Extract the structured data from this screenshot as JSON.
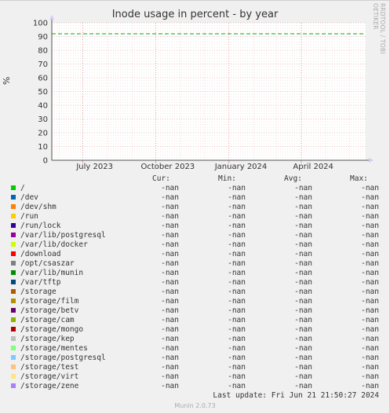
{
  "chart_data": {
    "type": "line",
    "title": "Inode usage in percent - by year",
    "ylabel": "%",
    "xlabel": "",
    "ylim": [
      0,
      100
    ],
    "xlim": [
      "2023-05-23",
      "2024-06-21"
    ],
    "y_ticks": [
      "0",
      "10",
      "20",
      "30",
      "40",
      "50",
      "60",
      "70",
      "80",
      "90",
      "100"
    ],
    "x_ticks": [
      {
        "label": "July 2023",
        "date": "2023-07-01"
      },
      {
        "label": "October 2023",
        "date": "2023-10-01"
      },
      {
        "label": "January 2024",
        "date": "2024-01-01"
      },
      {
        "label": "April 2024",
        "date": "2024-04-01"
      }
    ],
    "grid": true,
    "reference_line": {
      "value": 92,
      "color": "#00aa00",
      "style": "dashed"
    },
    "watermark": "RRDTOOL / TOBI OETIKER",
    "legend_headers": [
      "Cur:",
      "Min:",
      "Avg:",
      "Max:"
    ],
    "series": [
      {
        "name": "/",
        "color": "#00cc00",
        "cur": "-nan",
        "min": "-nan",
        "avg": "-nan",
        "max": "-nan"
      },
      {
        "name": "/dev",
        "color": "#0066b3",
        "cur": "-nan",
        "min": "-nan",
        "avg": "-nan",
        "max": "-nan"
      },
      {
        "name": "/dev/shm",
        "color": "#ff8000",
        "cur": "-nan",
        "min": "-nan",
        "avg": "-nan",
        "max": "-nan"
      },
      {
        "name": "/run",
        "color": "#ffcc00",
        "cur": "-nan",
        "min": "-nan",
        "avg": "-nan",
        "max": "-nan"
      },
      {
        "name": "/run/lock",
        "color": "#330099",
        "cur": "-nan",
        "min": "-nan",
        "avg": "-nan",
        "max": "-nan"
      },
      {
        "name": "/var/lib/postgresql",
        "color": "#990099",
        "cur": "-nan",
        "min": "-nan",
        "avg": "-nan",
        "max": "-nan"
      },
      {
        "name": "/var/lib/docker",
        "color": "#ccff00",
        "cur": "-nan",
        "min": "-nan",
        "avg": "-nan",
        "max": "-nan"
      },
      {
        "name": "/download",
        "color": "#ff0000",
        "cur": "-nan",
        "min": "-nan",
        "avg": "-nan",
        "max": "-nan"
      },
      {
        "name": "/opt/csaszar",
        "color": "#808080",
        "cur": "-nan",
        "min": "-nan",
        "avg": "-nan",
        "max": "-nan"
      },
      {
        "name": "/var/lib/munin",
        "color": "#008f00",
        "cur": "-nan",
        "min": "-nan",
        "avg": "-nan",
        "max": "-nan"
      },
      {
        "name": "/var/tftp",
        "color": "#00487d",
        "cur": "-nan",
        "min": "-nan",
        "avg": "-nan",
        "max": "-nan"
      },
      {
        "name": "/storage",
        "color": "#b35a00",
        "cur": "-nan",
        "min": "-nan",
        "avg": "-nan",
        "max": "-nan"
      },
      {
        "name": "/storage/film",
        "color": "#b38f00",
        "cur": "-nan",
        "min": "-nan",
        "avg": "-nan",
        "max": "-nan"
      },
      {
        "name": "/storage/betv",
        "color": "#6b006b",
        "cur": "-nan",
        "min": "-nan",
        "avg": "-nan",
        "max": "-nan"
      },
      {
        "name": "/storage/cam",
        "color": "#8fb300",
        "cur": "-nan",
        "min": "-nan",
        "avg": "-nan",
        "max": "-nan"
      },
      {
        "name": "/storage/mongo",
        "color": "#b30000",
        "cur": "-nan",
        "min": "-nan",
        "avg": "-nan",
        "max": "-nan"
      },
      {
        "name": "/storage/kep",
        "color": "#bebebe",
        "cur": "-nan",
        "min": "-nan",
        "avg": "-nan",
        "max": "-nan"
      },
      {
        "name": "/storage/mentes",
        "color": "#80ff80",
        "cur": "-nan",
        "min": "-nan",
        "avg": "-nan",
        "max": "-nan"
      },
      {
        "name": "/storage/postgresql",
        "color": "#80c9ff",
        "cur": "-nan",
        "min": "-nan",
        "avg": "-nan",
        "max": "-nan"
      },
      {
        "name": "/storage/test",
        "color": "#ffc080",
        "cur": "-nan",
        "min": "-nan",
        "avg": "-nan",
        "max": "-nan"
      },
      {
        "name": "/storage/virt",
        "color": "#ffe680",
        "cur": "-nan",
        "min": "-nan",
        "avg": "-nan",
        "max": "-nan"
      },
      {
        "name": "/storage/zene",
        "color": "#aa80ff",
        "cur": "-nan",
        "min": "-nan",
        "avg": "-nan",
        "max": "-nan"
      }
    ]
  },
  "last_update": "Last update: Fri Jun 21 21:50:27 2024",
  "footer": "Munin 2.0.73"
}
